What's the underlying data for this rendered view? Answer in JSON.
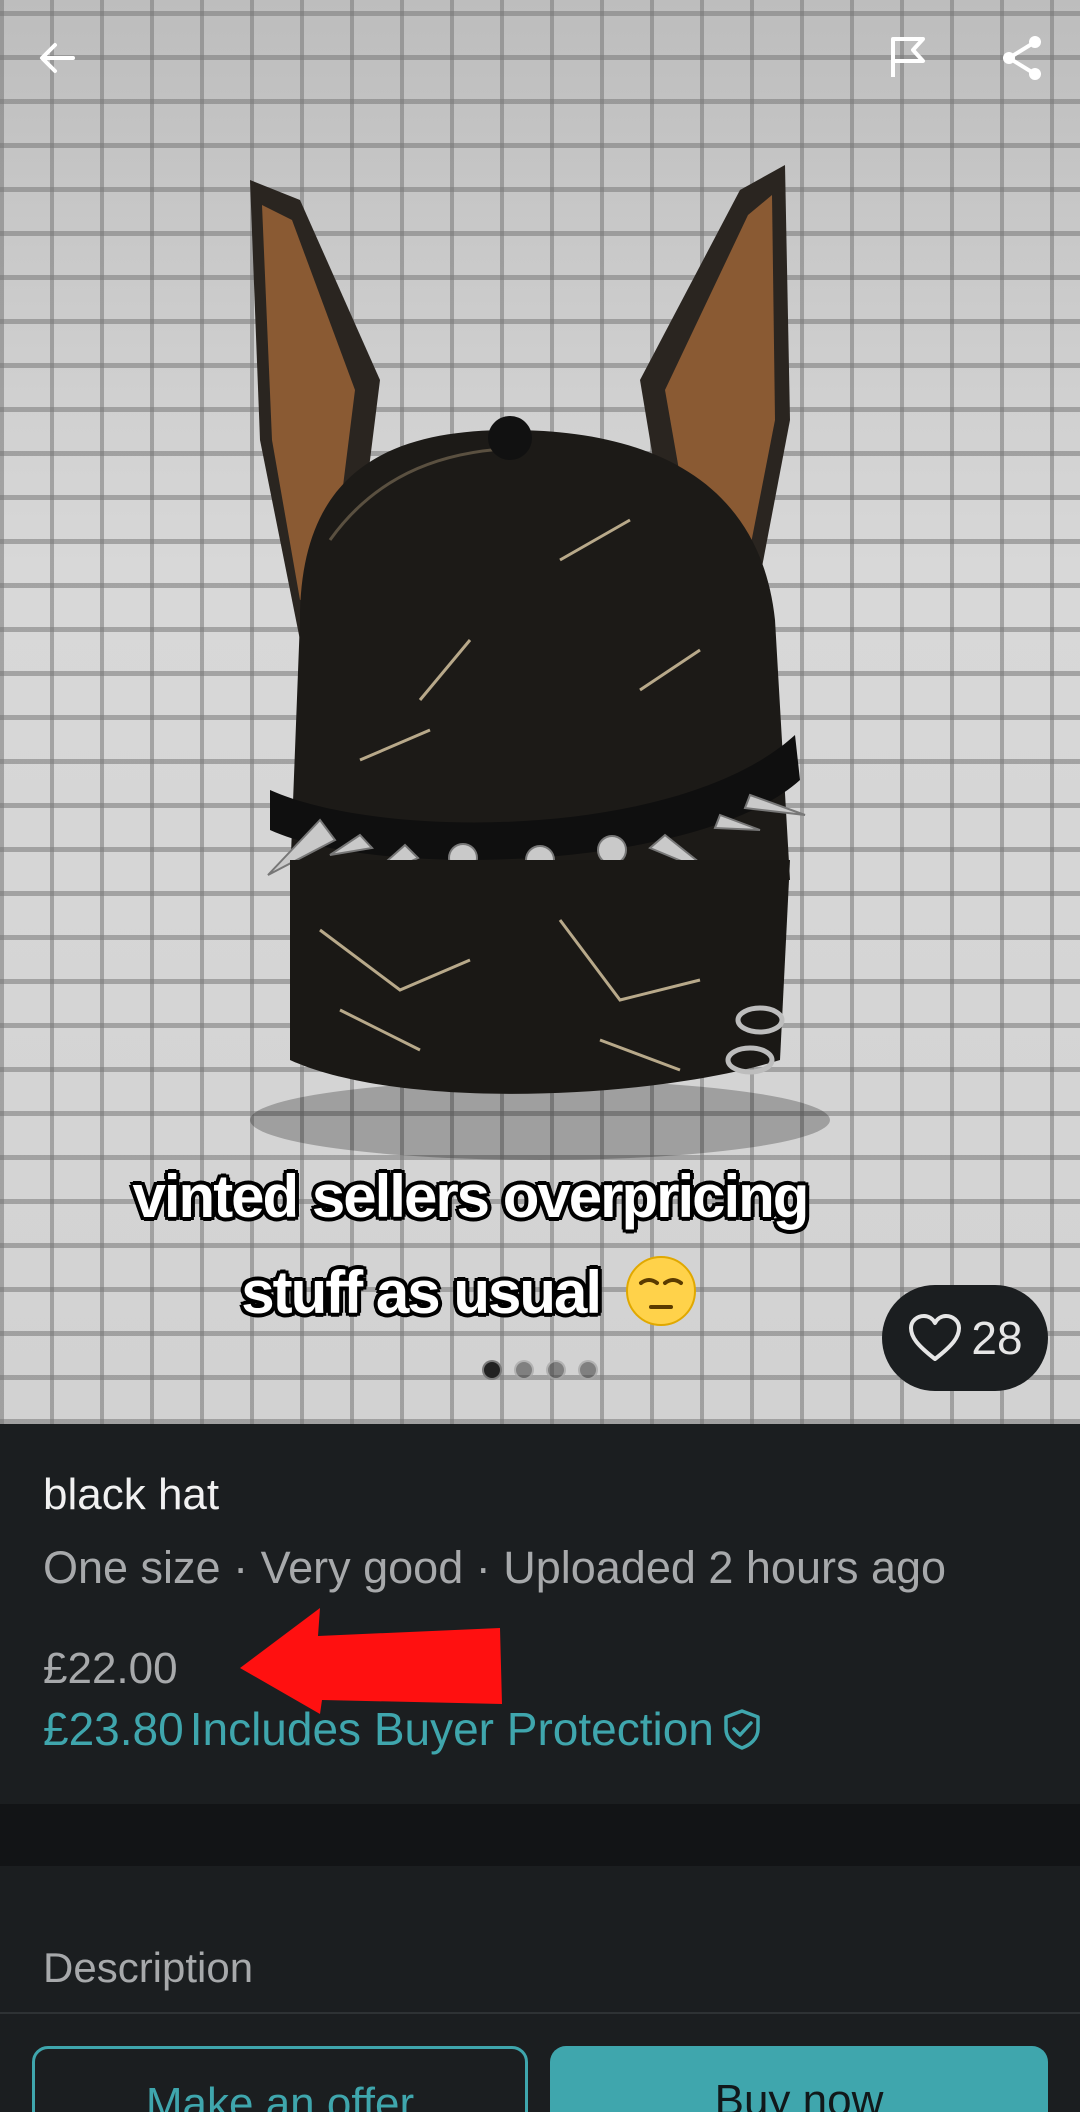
{
  "photo": {
    "caption_line1": "vinted sellers overpricing",
    "caption_line2": "stuff as usual",
    "caption_emoji": "relieved-face-emoji",
    "likes": "28",
    "dots": 4,
    "active_dot": 0
  },
  "topbar": {
    "back_icon": "arrow-left-icon",
    "report_icon": "flag-icon",
    "share_icon": "share-icon"
  },
  "item": {
    "title": "black hat",
    "meta": "One size · Very good · Uploaded 2 hours ago",
    "price": "£22.00",
    "total_price": "£23.80",
    "buyer_protection": "Includes Buyer Protection"
  },
  "description": {
    "label": "Description"
  },
  "actions": {
    "offer_label": "Make an offer",
    "buy_label": "Buy now"
  },
  "colors": {
    "accent": "#3fa6ad",
    "background": "#1b1e20",
    "annotation_arrow": "#ff1010"
  }
}
